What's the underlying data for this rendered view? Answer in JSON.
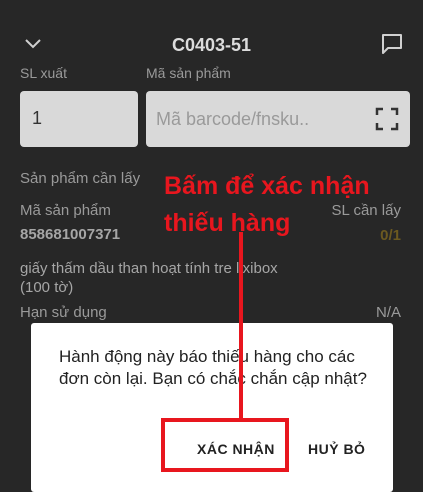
{
  "header": {
    "title": "C0403-51",
    "back_icon": "chevron-down-icon",
    "chat_icon": "chat-icon"
  },
  "form": {
    "qty_label": "SL xuất",
    "qty_value": "1",
    "sku_label": "Mã sản phẩm",
    "barcode_placeholder": "Mã barcode/fnsku..",
    "scan_icon": "scan-icon"
  },
  "product_section": {
    "title": "Sản phẩm cần lấy",
    "col_sku": "Mã sản phẩm",
    "col_qty": "SL cần lấy",
    "sku": "858681007371",
    "qty_ratio": "0/1",
    "name": "giấy thấm dầu than hoạt tính tre lixibox (100 tờ)",
    "expiry_label": "Hạn sử dụng",
    "expiry_value": "N/A"
  },
  "annotation": {
    "line1": "Bấm để xác nhận",
    "line2": "thiếu hàng"
  },
  "dialog": {
    "message": "Hành động này báo thiếu hàng cho các đơn còn lại. Bạn có chắc chắn cập nhật?",
    "confirm_label": "XÁC NHẬN",
    "cancel_label": "HUỶ BỎ"
  },
  "colors": {
    "annotation_red": "#e8161e",
    "background": "#272727",
    "dialog": "#ffffff",
    "qty_accent": "#6b5920"
  }
}
